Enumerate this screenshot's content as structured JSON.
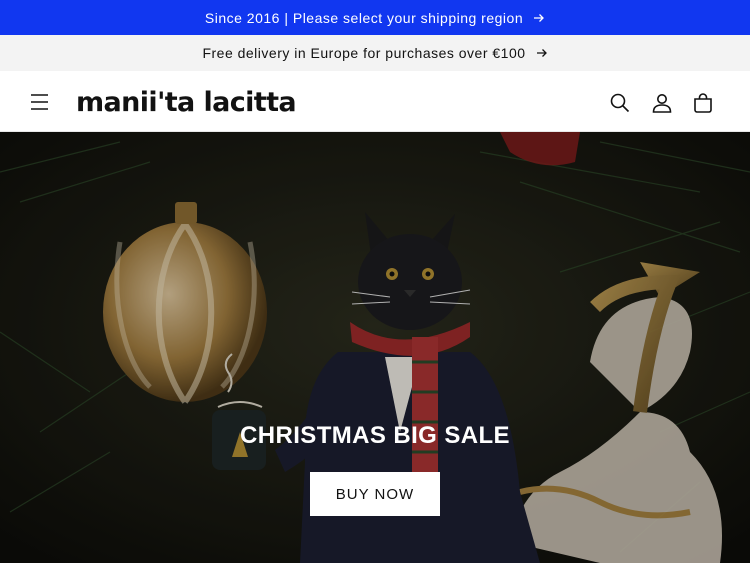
{
  "announcements": {
    "region": "Since 2016 | Please select your shipping region",
    "delivery": "Free delivery in Europe for purchases over €100"
  },
  "header": {
    "logo": "manii'ta lacitta",
    "icons": [
      "menu-icon",
      "search-icon",
      "account-icon",
      "cart-icon"
    ]
  },
  "hero": {
    "title": "CHRISTMAS BIG SALE",
    "button_label": "BUY NOW"
  },
  "colors": {
    "announcement_bg": "#1137f0",
    "delivery_bg": "#f3f3f3",
    "text": "#121212",
    "button_bg": "#ffffff"
  }
}
